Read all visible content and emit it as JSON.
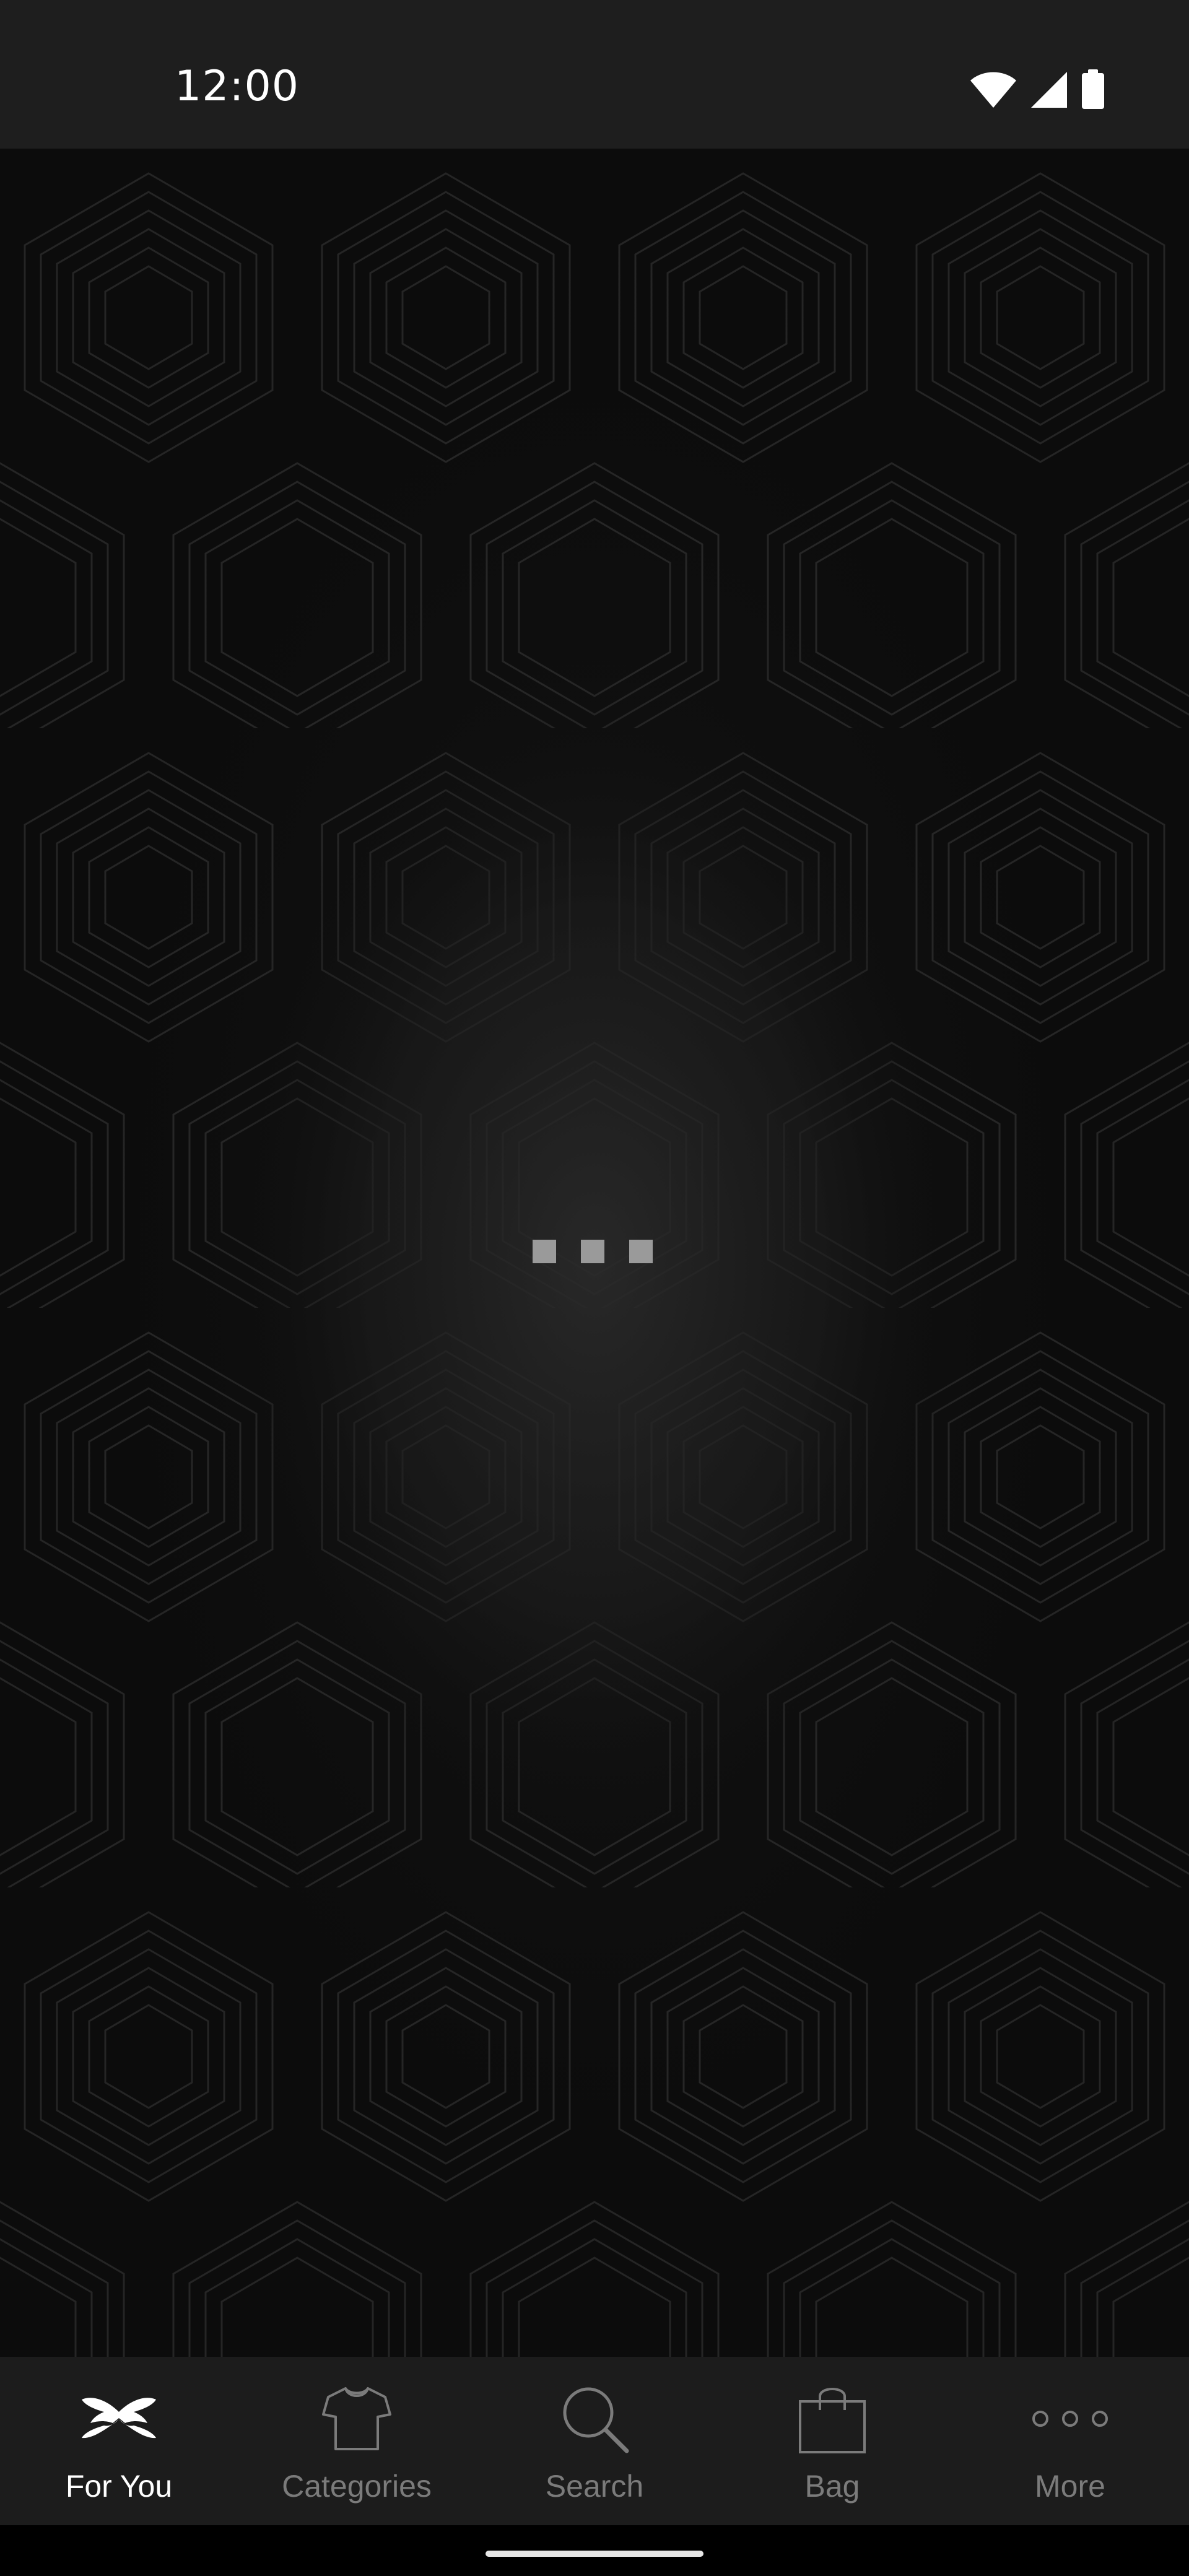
{
  "status_bar": {
    "time": "12:00",
    "icons": [
      "wifi-icon",
      "signal-icon",
      "battery-icon"
    ]
  },
  "loader": {
    "dot_count": 3,
    "color": "#9a9a9a"
  },
  "bottom_nav": {
    "items": [
      {
        "label": "For You",
        "icon": "under-armour-logo-icon",
        "active": true
      },
      {
        "label": "Categories",
        "icon": "shirt-icon",
        "active": false
      },
      {
        "label": "Search",
        "icon": "search-icon",
        "active": false
      },
      {
        "label": "Bag",
        "icon": "bag-icon",
        "active": false
      },
      {
        "label": "More",
        "icon": "more-dots-icon",
        "active": false
      }
    ]
  },
  "colors": {
    "background": "#0b0b0b",
    "status_bar": "#1e1e1e",
    "nav_bar": "#1c1c1c",
    "active_label": "#ffffff",
    "inactive_label": "#7b7b7b"
  }
}
